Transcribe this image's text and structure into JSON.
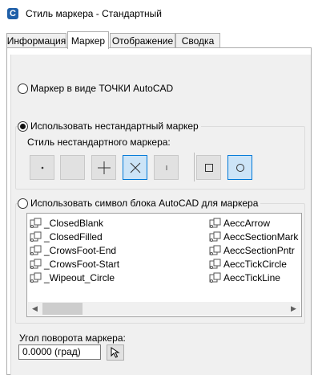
{
  "window": {
    "title": "Стиль маркера - Стандартный",
    "app_icon": "civil3d-app-icon",
    "app_icon_letter": "C"
  },
  "tabs": [
    {
      "label": "Информация",
      "active": false
    },
    {
      "label": "Маркер",
      "active": true
    },
    {
      "label": "Отображение",
      "active": false
    },
    {
      "label": "Сводка",
      "active": false
    }
  ],
  "marker": {
    "option_point": "Маркер в виде ТОЧКИ AutoCAD",
    "option_custom": "Использовать нестандартный маркер",
    "custom_style_label": "Стиль нестандартного маркера:",
    "option_block": "Использовать символ блока AutoCAD для маркера",
    "selected_option": "custom",
    "custom_buttons": [
      {
        "icon": "dot-marker-icon",
        "selected": false
      },
      {
        "icon": "none-marker-icon",
        "selected": false
      },
      {
        "icon": "plus-marker-icon",
        "selected": false
      },
      {
        "icon": "x-marker-icon",
        "selected": true
      },
      {
        "icon": "tick-marker-icon",
        "selected": false
      },
      {
        "icon": "square-marker-icon",
        "selected": false
      },
      {
        "icon": "circle-marker-icon",
        "selected": true
      }
    ],
    "blocks_col1": [
      "_ClosedBlank",
      "_ClosedFilled",
      "_CrowsFoot-End",
      "_CrowsFoot-Start",
      "_Wipeout_Circle"
    ],
    "blocks_col2": [
      "AeccArrow",
      "AeccSectionMark",
      "AeccSectionPntr",
      "AeccTickCircle",
      "AeccTickLine"
    ],
    "rotation_label": "Угол поворота маркера:",
    "rotation_value": "0.0000 (град)"
  },
  "colors": {
    "accent": "#0078d7",
    "selected_bg": "#cce4f7",
    "app_icon": "#1f5fa8"
  }
}
